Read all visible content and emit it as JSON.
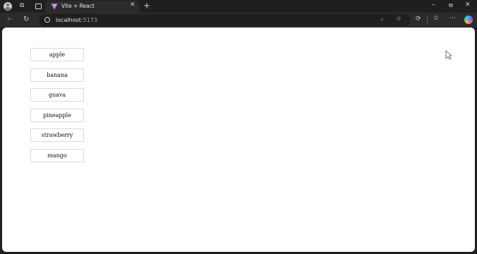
{
  "browser": {
    "tab_title": "Vite + React",
    "url_host": "localhost",
    "url_port": ":5173"
  },
  "list": {
    "items": [
      "apple",
      "banana",
      "guava",
      "pineapple",
      "strawberry",
      "mango"
    ]
  },
  "colors": {
    "chrome_dark": "#1f1f1f",
    "toolbar": "#2b2b2b",
    "page_bg": "#ffffff",
    "item_border": "#d9d9d9"
  },
  "icons": [
    "profile-icon",
    "workspaces-icon",
    "tab-actions-icon",
    "vite-logo-icon",
    "tab-close-icon",
    "new-tab-icon",
    "minimize-icon",
    "restore-icon",
    "window-close-icon",
    "back-icon",
    "refresh-icon",
    "site-info-icon",
    "zoom-icon",
    "favorite-icon",
    "extensions-icon",
    "favorites-icon",
    "more-icon",
    "copilot-icon",
    "mouse-cursor-icon"
  ]
}
